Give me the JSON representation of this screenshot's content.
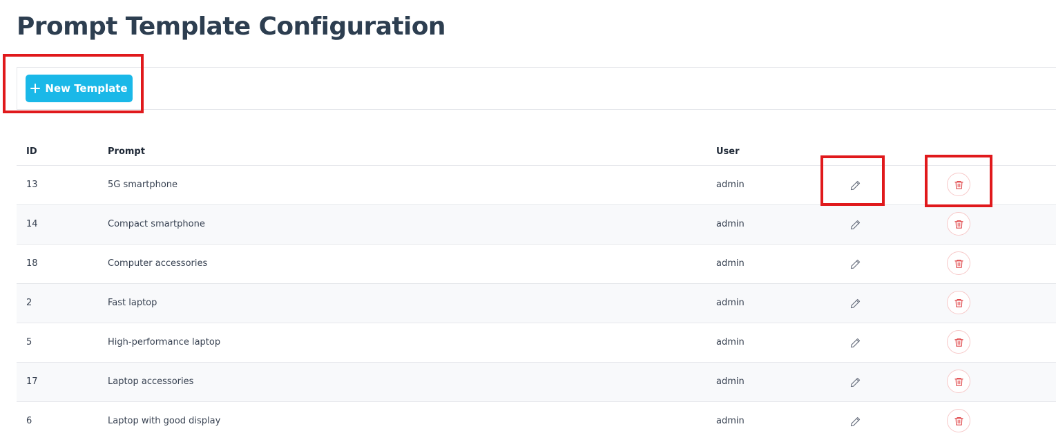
{
  "page": {
    "title": "Prompt Template Configuration"
  },
  "toolbar": {
    "new_label": "New Template",
    "new_icon": "plus-icon",
    "accent": "#1ab8e8"
  },
  "table": {
    "columns": {
      "id": "ID",
      "prompt": "Prompt",
      "user": "User"
    },
    "rows": [
      {
        "id": "13",
        "prompt": "5G smartphone",
        "user": "admin"
      },
      {
        "id": "14",
        "prompt": "Compact smartphone",
        "user": "admin"
      },
      {
        "id": "18",
        "prompt": "Computer accessories",
        "user": "admin"
      },
      {
        "id": "2",
        "prompt": "Fast laptop",
        "user": "admin"
      },
      {
        "id": "5",
        "prompt": "High-performance laptop",
        "user": "admin"
      },
      {
        "id": "17",
        "prompt": "Laptop accessories",
        "user": "admin"
      },
      {
        "id": "6",
        "prompt": "Laptop with good display",
        "user": "admin"
      }
    ],
    "row_actions": {
      "edit_icon": "pencil-icon",
      "delete_icon": "trash-icon",
      "delete_color": "#e0484b"
    }
  },
  "highlight_color": "#e0191c"
}
